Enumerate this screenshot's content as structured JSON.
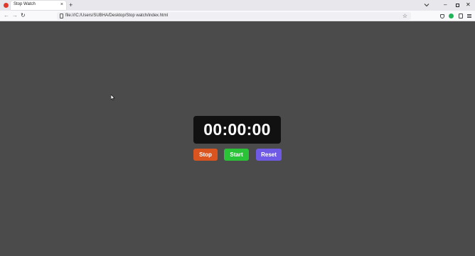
{
  "browser": {
    "tab": {
      "title": "Stop Watch",
      "close_glyph": "×"
    },
    "new_tab_glyph": "+",
    "tab_list_icon": "chevron-down-icon",
    "window": {
      "minimize_glyph": "–",
      "close_glyph": "✕"
    },
    "nav": {
      "back_glyph": "←",
      "forward_glyph": "→",
      "reload_glyph": "↻"
    },
    "url": "file:///C:/Users/SUBHA/Desktop/Stop watch/index.html",
    "bookmark_glyph": "☆",
    "accent_account": "#20b35a"
  },
  "stopwatch": {
    "time": "00:00:00",
    "buttons": {
      "stop": "Stop",
      "start": "Start",
      "reset": "Reset"
    },
    "colors": {
      "background": "#4b4b4b",
      "display": "#111111",
      "stop": "#d9541f",
      "start": "#2ac236",
      "reset": "#6f5ae6"
    }
  }
}
